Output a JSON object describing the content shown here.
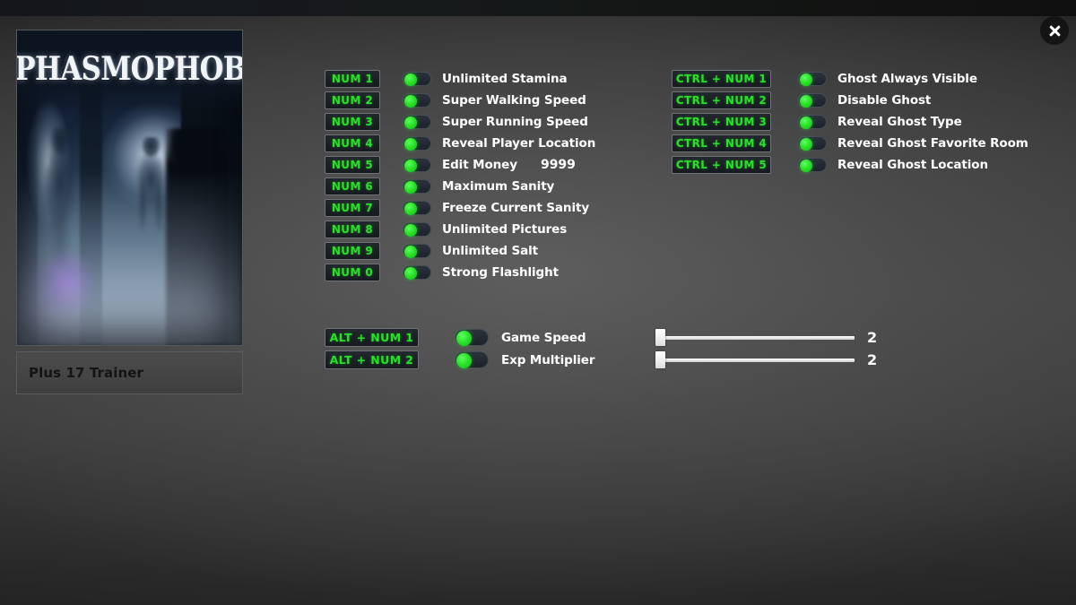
{
  "window": {
    "close_label": "✕",
    "close_icon": "close-icon"
  },
  "game": {
    "title": "PHASMOPHOBIA",
    "trainer_label": "Plus 17 Trainer",
    "cover_art_icon": "game-cover-art"
  },
  "colors": {
    "hotkey_text": "#28e028",
    "toggle_on": "#2ae02a",
    "label_text": "#ffffff",
    "panel_bg": "#454545"
  },
  "cheats": {
    "column_left": [
      {
        "hotkey": "NUM 1",
        "label": "Unlimited Stamina",
        "toggle": "on"
      },
      {
        "hotkey": "NUM 2",
        "label": "Super Walking Speed",
        "toggle": "on"
      },
      {
        "hotkey": "NUM 3",
        "label": "Super Running Speed",
        "toggle": "on"
      },
      {
        "hotkey": "NUM 4",
        "label": "Reveal Player Location",
        "toggle": "on"
      },
      {
        "hotkey": "NUM 5",
        "label": "Edit Money",
        "toggle": "on",
        "value": "9999"
      },
      {
        "hotkey": "NUM 6",
        "label": "Maximum Sanity",
        "toggle": "on"
      },
      {
        "hotkey": "NUM 7",
        "label": "Freeze Current Sanity",
        "toggle": "on"
      },
      {
        "hotkey": "NUM 8",
        "label": "Unlimited Pictures",
        "toggle": "on"
      },
      {
        "hotkey": "NUM 9",
        "label": "Unlimited Salt",
        "toggle": "on"
      },
      {
        "hotkey": "NUM 0",
        "label": "Strong Flashlight",
        "toggle": "on"
      }
    ],
    "column_right": [
      {
        "hotkey": "CTRL + NUM 1",
        "label": "Ghost Always Visible",
        "toggle": "on"
      },
      {
        "hotkey": "CTRL + NUM 2",
        "label": "Disable Ghost",
        "toggle": "on"
      },
      {
        "hotkey": "CTRL + NUM 3",
        "label": "Reveal Ghost Type",
        "toggle": "on"
      },
      {
        "hotkey": "CTRL + NUM 4",
        "label": "Reveal Ghost Favorite Room",
        "toggle": "on"
      },
      {
        "hotkey": "CTRL + NUM 5",
        "label": "Reveal Ghost Location",
        "toggle": "on"
      }
    ]
  },
  "sliders": [
    {
      "hotkey": "ALT + NUM 1",
      "label": "Game Speed",
      "toggle": "on",
      "value": "2",
      "fill_percent": 0
    },
    {
      "hotkey": "ALT + NUM 2",
      "label": "Exp Multiplier",
      "toggle": "on",
      "value": "2",
      "fill_percent": 0
    }
  ]
}
